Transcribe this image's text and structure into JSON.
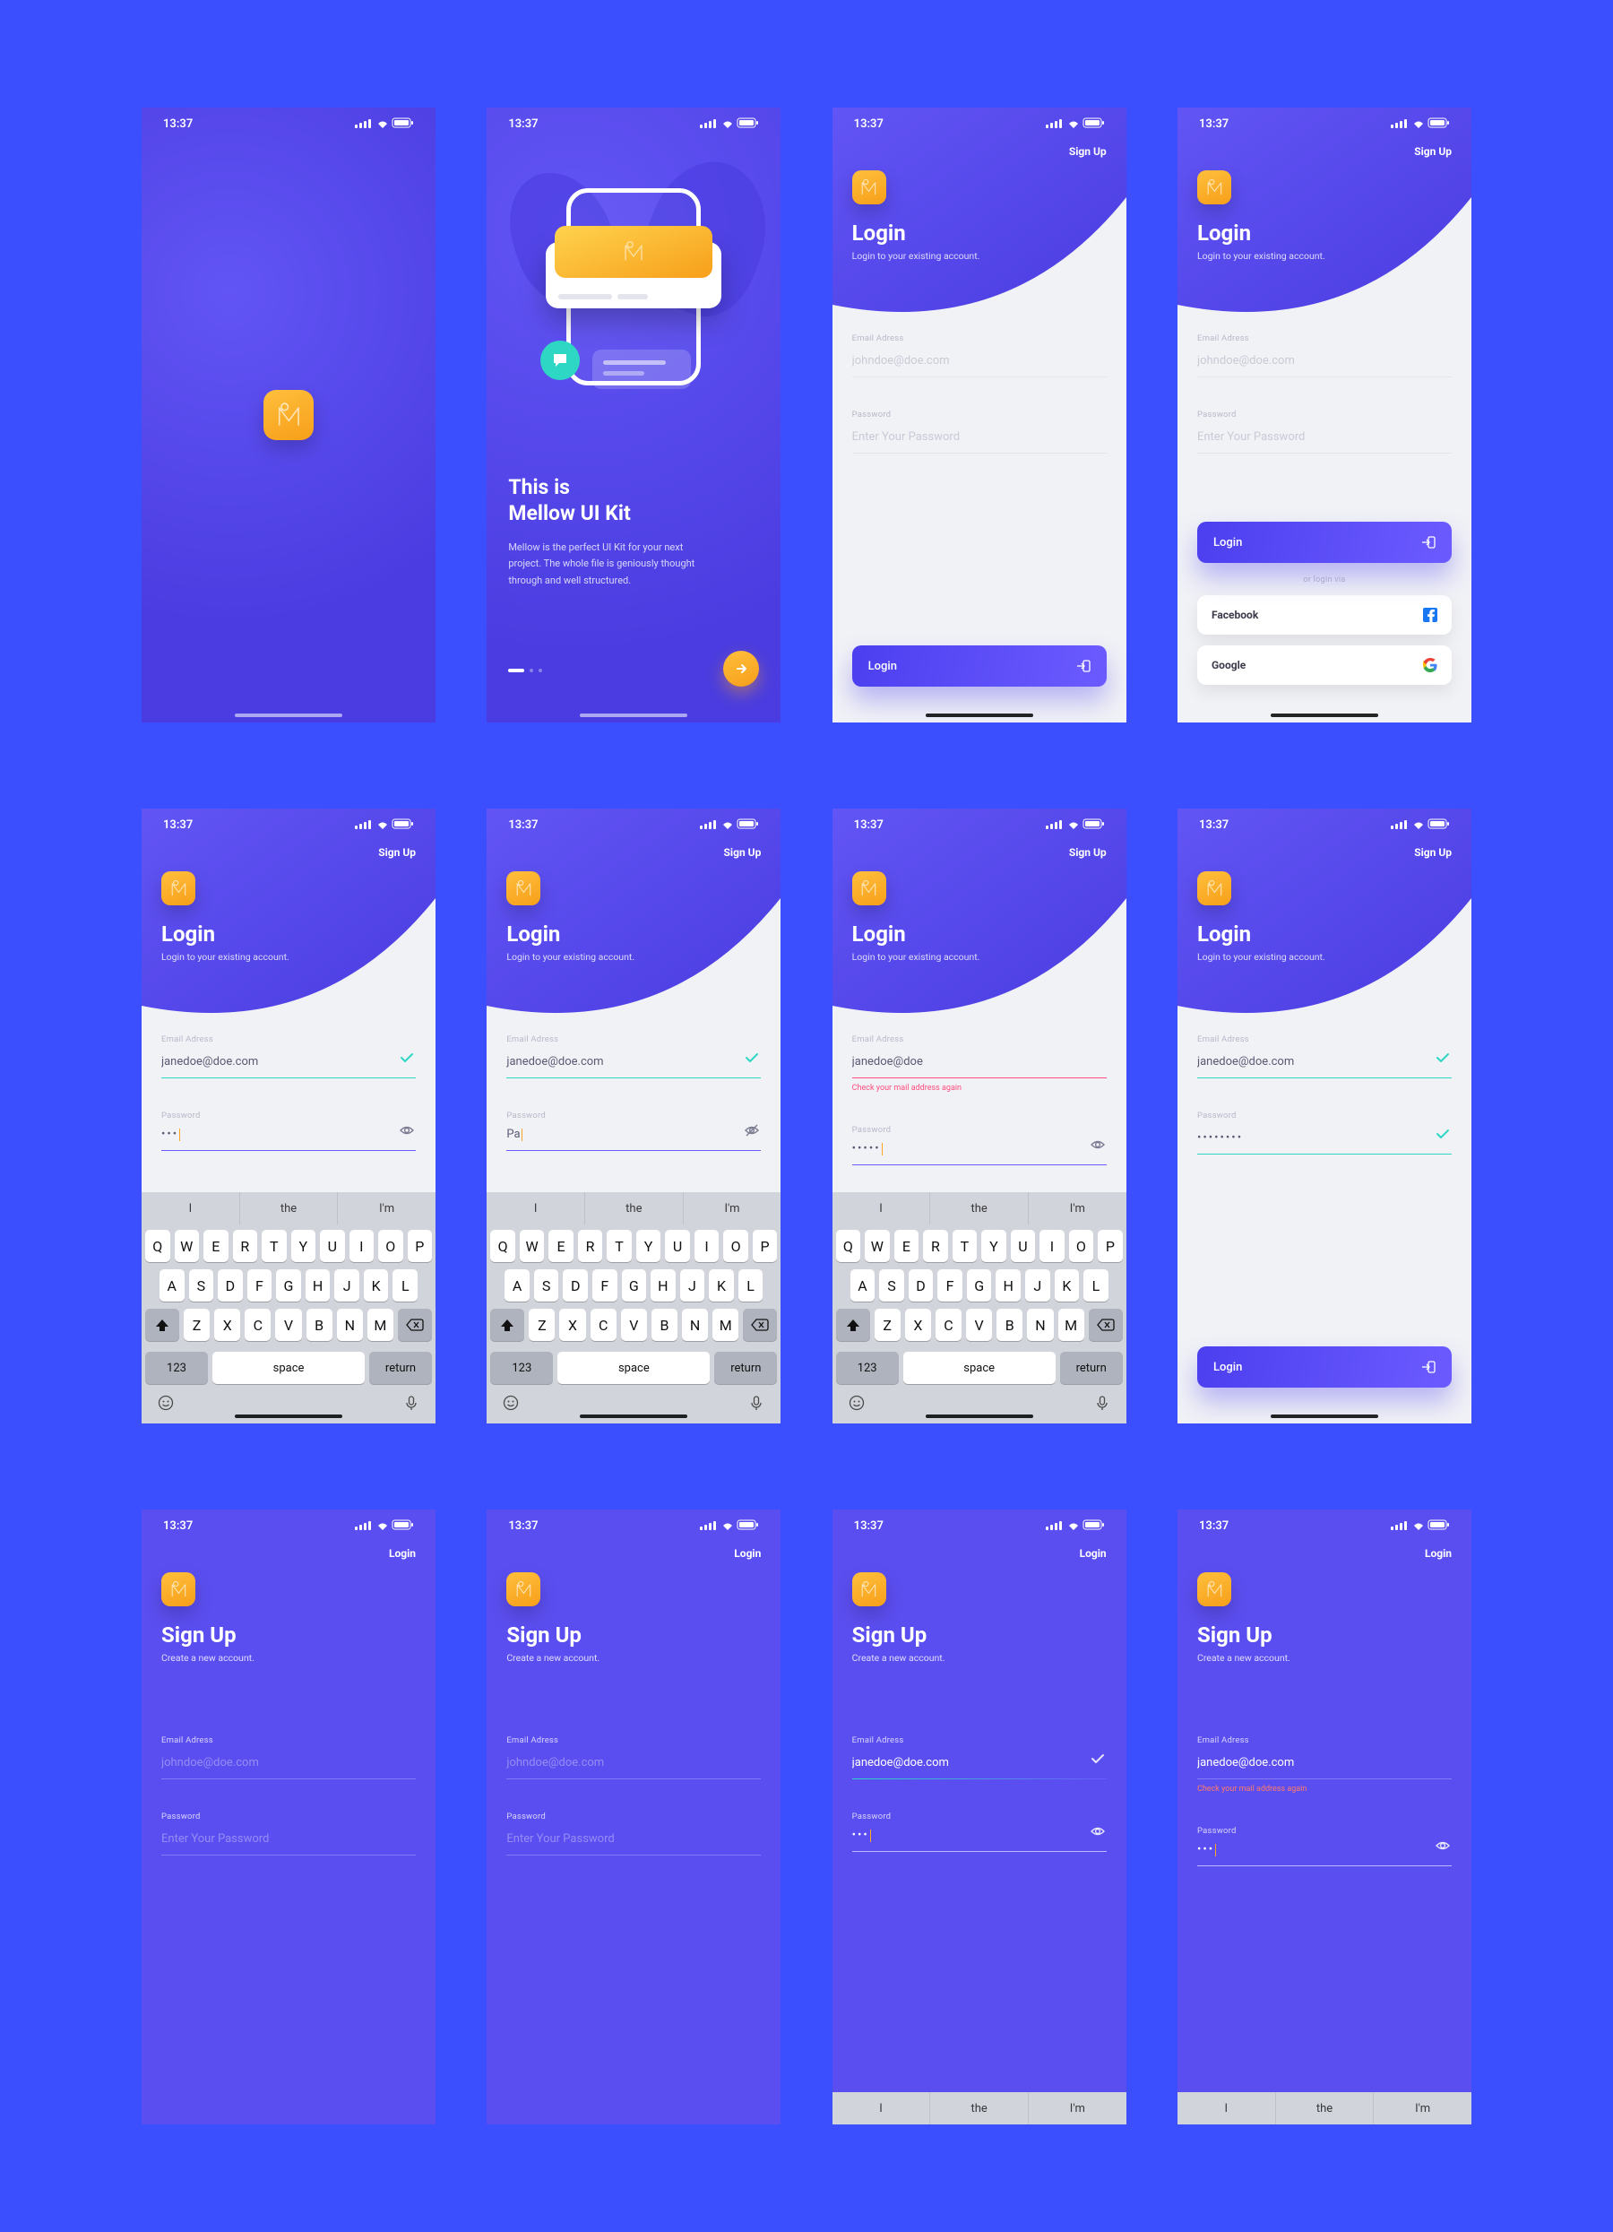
{
  "status": {
    "time": "13:37"
  },
  "nav": {
    "signup": "Sign Up",
    "login": "Login"
  },
  "splash": {},
  "onboarding": {
    "title_l1": "This is",
    "title_l2": "Mellow UI Kit",
    "body": "Mellow is the perfect UI Kit for your next project. The whole file is geniously thought through and well structured."
  },
  "login": {
    "title": "Login",
    "subtitle": "Login to your existing account.",
    "email_label": "Email Adress",
    "email_placeholder": "johndoe@doe.com",
    "password_label": "Password",
    "password_placeholder": "Enter Your Password",
    "button": "Login",
    "or": "or login via",
    "social": {
      "facebook": "Facebook",
      "google": "Google"
    },
    "samples": {
      "jane": "janedoe@doe.com",
      "jane_short": "janedoe@doe",
      "pw_typing": "Pa",
      "pw_dots5": "•••••",
      "pw_dots8": "••••••••"
    },
    "error": "Check your mail address again"
  },
  "signup": {
    "title": "Sign Up",
    "subtitle": "Create a new account.",
    "email_label": "Email Adress",
    "email_placeholder": "johndoe@doe.com",
    "password_label": "Password",
    "password_placeholder": "Enter Your Password",
    "error": "Check your mail address again",
    "samples": {
      "jane": "janedoe@doe.com",
      "pw_dots3": "•••"
    }
  },
  "keyboard": {
    "suggestions": [
      "I",
      "the",
      "I'm"
    ],
    "row1": [
      "Q",
      "W",
      "E",
      "R",
      "T",
      "Y",
      "U",
      "I",
      "O",
      "P"
    ],
    "row2": [
      "A",
      "S",
      "D",
      "F",
      "G",
      "H",
      "J",
      "K",
      "L"
    ],
    "row3": [
      "Z",
      "X",
      "C",
      "V",
      "B",
      "N",
      "M"
    ],
    "numkey": "123",
    "space": "space",
    "return": "return"
  },
  "colors": {
    "bg": "#3B4FFF",
    "purple_a": "#5B4EF0",
    "purple_b": "#4A3CE0",
    "accent": "#F79F1A",
    "teal": "#2DD7C4",
    "error": "#FF4D7E"
  }
}
